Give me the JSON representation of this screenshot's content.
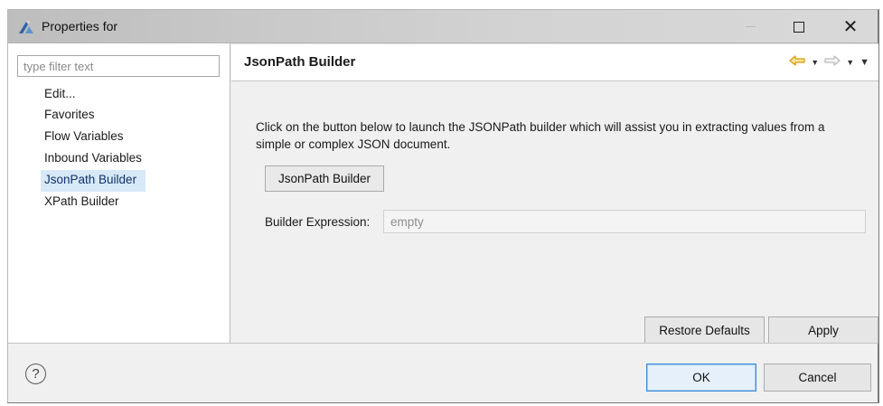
{
  "window": {
    "title": "Properties for",
    "icon": "eclipse-properties-icon",
    "controls": [
      "minimize",
      "maximize",
      "close"
    ]
  },
  "sidebar": {
    "filter_placeholder": "type filter text",
    "items": [
      {
        "label": "Edit..."
      },
      {
        "label": "Favorites"
      },
      {
        "label": "Flow Variables"
      },
      {
        "label": "Inbound Variables"
      },
      {
        "label": "JsonPath Builder",
        "selected": true
      },
      {
        "label": "XPath Builder"
      }
    ]
  },
  "content": {
    "title": "JsonPath Builder",
    "description": "Click on the button below to launch the JSONPath builder which will assist you in extracting values from a simple or complex JSON document.",
    "builder_button_label": "JsonPath Builder",
    "expression_label": "Builder Expression:",
    "expression_value": "empty",
    "restore_defaults_label": "Restore Defaults",
    "apply_label": "Apply",
    "nav_icons": [
      "back-arrow-icon",
      "back-dropdown-icon",
      "forward-arrow-icon",
      "forward-dropdown-icon",
      "view-menu-icon"
    ]
  },
  "footer": {
    "help_icon": "help-icon",
    "ok_label": "OK",
    "cancel_label": "Cancel"
  },
  "colors": {
    "selection_bg": "#d7e9f7",
    "back_arrow": "#e8b10c",
    "default_button_border": "#3c8ad8"
  }
}
